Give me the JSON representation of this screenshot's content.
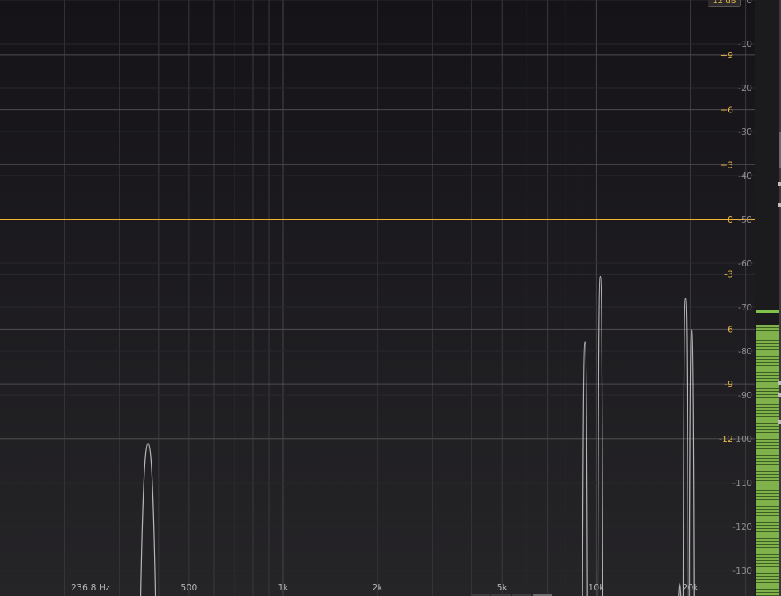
{
  "range_label": "12 dB",
  "colors": {
    "background_top": "#151318",
    "background_bottom": "#242326",
    "grid_line": "#3b393d",
    "eq_grid_line": "#4e4c4f",
    "eq_curve": "#f2b233",
    "eq_label": "#e8b64a",
    "spectrum_label": "#8c8a8d",
    "freq_label": "#b4b2b5",
    "spectrum_line": "#cfcfd1",
    "meter_green": "#7fb24a"
  },
  "eq_gain_labels": [
    "+9",
    "+6",
    "+3",
    "0",
    "-3",
    "-6",
    "-9",
    "-12"
  ],
  "spectrum_db_labels": [
    "0",
    "-10",
    "-20",
    "-30",
    "-40",
    "-50",
    "-60",
    "-70",
    "-80",
    "-90",
    "-100",
    "-110",
    "-120",
    "-130"
  ],
  "freq_labels": [
    {
      "text": "236.8 Hz",
      "hz": 236.8
    },
    {
      "text": "500",
      "hz": 500
    },
    {
      "text": "1k",
      "hz": 1000
    },
    {
      "text": "2k",
      "hz": 2000
    },
    {
      "text": "5k",
      "hz": 5000
    },
    {
      "text": "10k",
      "hz": 10000
    },
    {
      "text": "20k",
      "hz": 20000
    }
  ],
  "eq_curve_gain_db": 0,
  "spectrum_peaks": [
    {
      "hz": 370,
      "db": -101
    },
    {
      "hz": 9200,
      "db": -78
    },
    {
      "hz": 10300,
      "db": -63
    },
    {
      "hz": 18500,
      "db": -133
    },
    {
      "hz": 19300,
      "db": -68
    },
    {
      "hz": 20200,
      "db": -75
    }
  ],
  "meter": {
    "level_db": -73,
    "peak_db": -71
  }
}
